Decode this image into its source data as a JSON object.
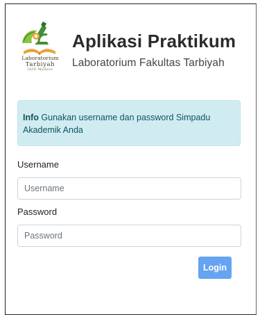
{
  "header": {
    "title": "Aplikasi Praktikum",
    "subtitle": "Laboratorium Fakultas Tarbiyah",
    "logo": {
      "icon": "microscope-book-logo",
      "line1": "Laboratorium",
      "line2": "Tarbiyah",
      "line3": "IAIN Madura"
    }
  },
  "alert": {
    "strong": "Info",
    "message": "Gunakan username dan password Simpadu Akademik Anda"
  },
  "form": {
    "username_label": "Username",
    "username_placeholder": "Username",
    "username_value": "",
    "password_label": "Password",
    "password_placeholder": "Password",
    "password_value": "",
    "login_label": "Login"
  },
  "colors": {
    "alert_bg": "#d1ecf1",
    "alert_text": "#0c5460",
    "login_button": "#66a3f0",
    "logo_green": "#3f8f3a",
    "logo_orange": "#e9a23b"
  }
}
